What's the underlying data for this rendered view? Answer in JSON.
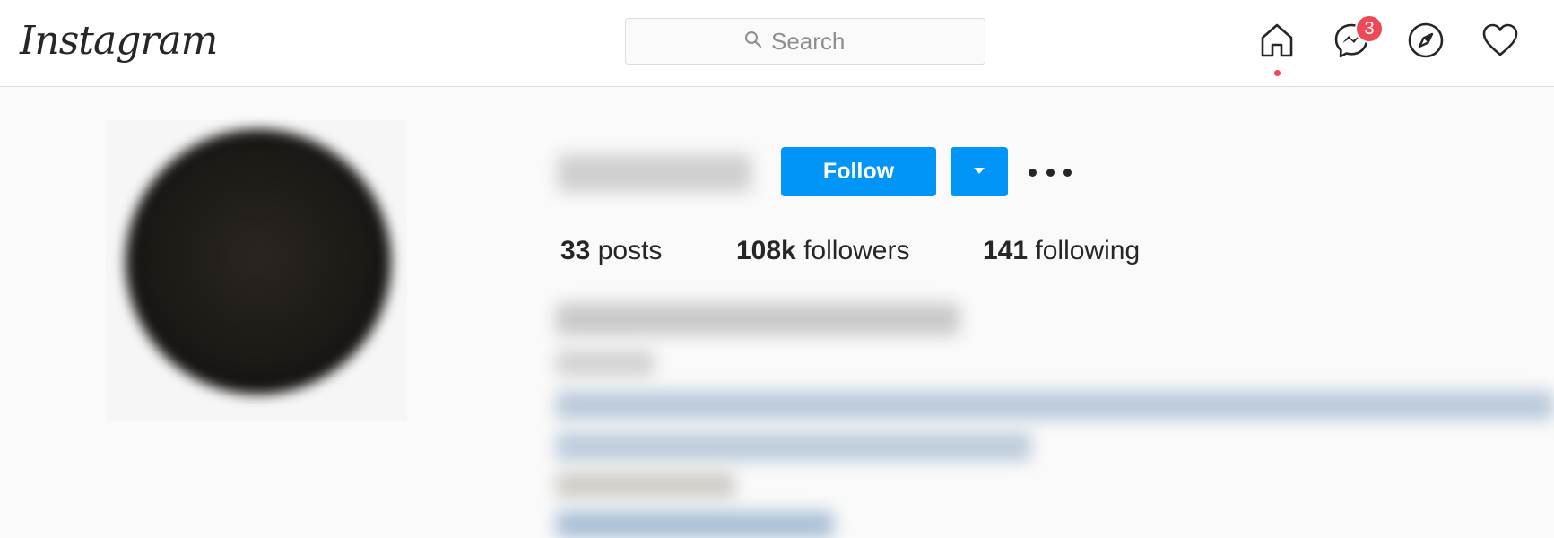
{
  "app": {
    "logo_text": "Instagram"
  },
  "header": {
    "search_placeholder": "Search",
    "messages_badge": "3",
    "icons": [
      "home-icon",
      "messenger-icon",
      "explore-compass-icon",
      "activity-heart-icon"
    ]
  },
  "profile": {
    "username": "",
    "follow_label": "Follow",
    "stats": {
      "posts_count": "33",
      "posts_label": "posts",
      "followers_count": "108k",
      "followers_label": "followers",
      "following_count": "141",
      "following_label": "following"
    }
  },
  "colors": {
    "accent_blue": "#0095f6",
    "notification_red": "#ed4956",
    "text_primary": "#262626",
    "background": "#fafafa"
  }
}
